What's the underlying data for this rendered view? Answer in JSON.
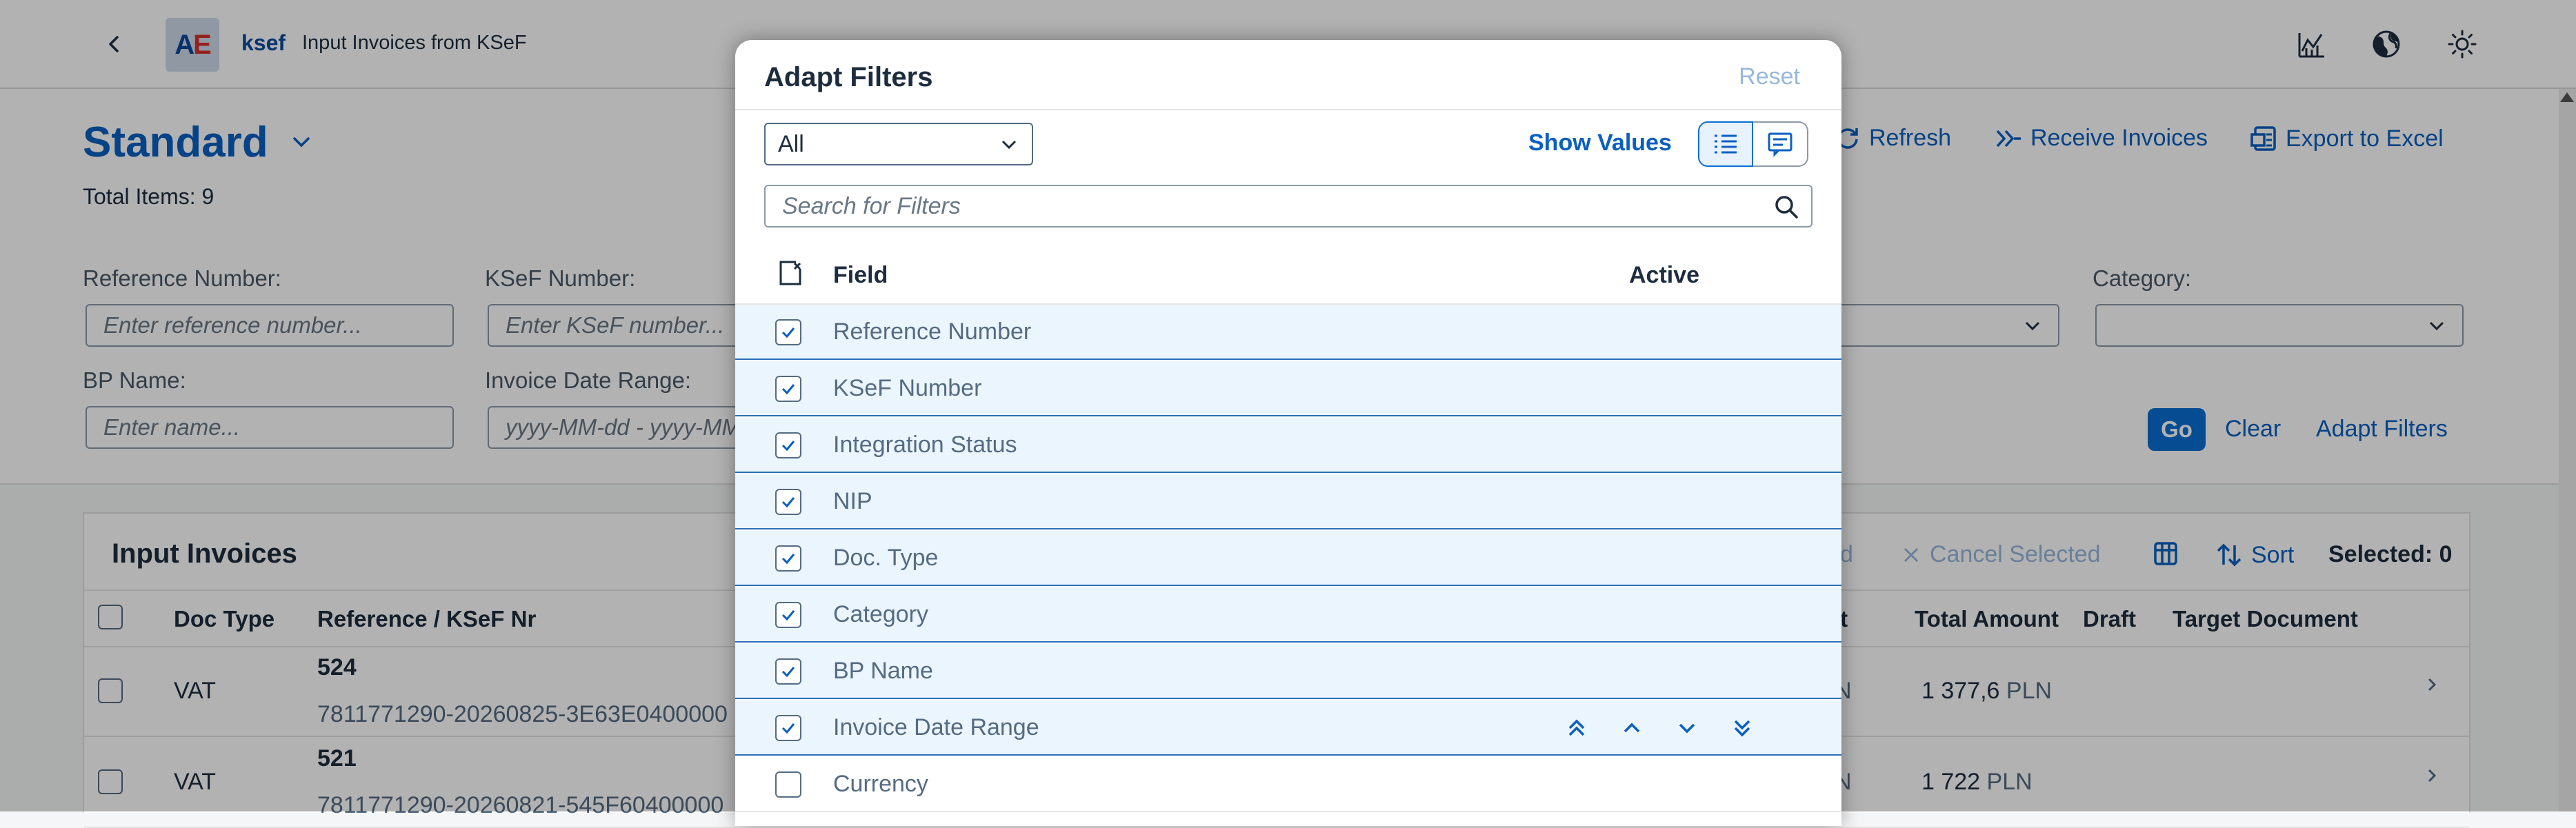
{
  "shell": {
    "app_name": "ksef",
    "app_title": "Input Invoices from KSeF",
    "logo_text_a": "A",
    "logo_text_e": "E",
    "icons": [
      "back-icon",
      "analytics-icon",
      "globe-icon",
      "theme-icon"
    ]
  },
  "header": {
    "variant": "Standard",
    "total_items": "Total Items: 9",
    "actions": {
      "refresh": "Refresh",
      "receive": "Receive Invoices",
      "export": "Export to Excel"
    }
  },
  "filters": {
    "reference_label": "Reference Number:",
    "reference_placeholder": "Enter reference number...",
    "ksef_label": "KSeF Number:",
    "ksef_placeholder": "Enter KSeF number...",
    "bp_label": "BP Name:",
    "bp_placeholder": "Enter name...",
    "date_label": "Invoice Date Range:",
    "date_placeholder": "yyyy-MM-dd - yyyy-MM-dd",
    "category_label": "Category:",
    "go": "Go",
    "clear": "Clear",
    "adapt": "Adapt Filters"
  },
  "table": {
    "title": "Input Invoices",
    "toolbar": {
      "partial_label": "d",
      "cancel_selected": "Cancel Selected",
      "sort": "Sort",
      "selected": "Selected: 0"
    },
    "columns": {
      "doc_type": "Doc Type",
      "reference": "Reference / KSeF Nr",
      "net_partial": "nt",
      "total_amount": "Total Amount",
      "draft": "Draft",
      "target": "Target Document"
    },
    "rows": [
      {
        "doc_type": "VAT",
        "ref": "524",
        "ksef": "7811771290-20260825-3E63E0400000",
        "net_partial": "N",
        "total": "1 377,6",
        "currency": "PLN"
      },
      {
        "doc_type": "VAT",
        "ref": "521",
        "ksef": "7811771290-20260821-545F60400000",
        "net_partial": "N",
        "total": "1 722",
        "currency": "PLN"
      }
    ]
  },
  "dialog": {
    "title": "Adapt Filters",
    "reset": "Reset",
    "select_value": "All",
    "show_values": "Show Values",
    "search_placeholder": "Search for Filters",
    "col_field": "Field",
    "col_active": "Active",
    "fields": [
      {
        "label": "Reference Number",
        "checked": true
      },
      {
        "label": "KSeF Number",
        "checked": true
      },
      {
        "label": "Integration Status",
        "checked": true
      },
      {
        "label": "NIP",
        "checked": true
      },
      {
        "label": "Doc. Type",
        "checked": true
      },
      {
        "label": "Category",
        "checked": true
      },
      {
        "label": "BP Name",
        "checked": true
      },
      {
        "label": "Invoice Date Range",
        "checked": true
      },
      {
        "label": "Currency",
        "checked": false
      }
    ]
  },
  "colors": {
    "brand_blue": "#0a5fc1",
    "selected_row_bg": "#ebf5fe",
    "go_button": "#0a6ed1"
  }
}
